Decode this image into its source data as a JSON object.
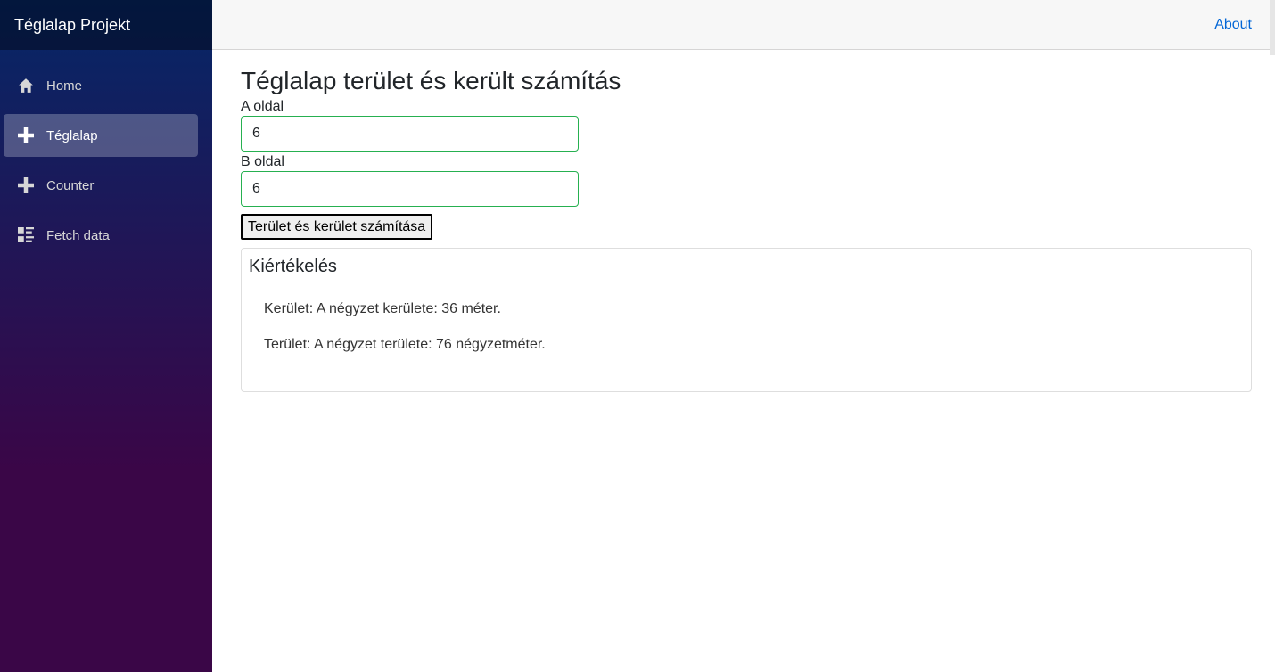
{
  "app": {
    "brand": "Téglalap Projekt"
  },
  "sidebar": {
    "items": [
      {
        "label": "Home",
        "icon": "home-icon",
        "active": false
      },
      {
        "label": "Téglalap",
        "icon": "plus-icon",
        "active": true
      },
      {
        "label": "Counter",
        "icon": "plus-icon",
        "active": false
      },
      {
        "label": "Fetch data",
        "icon": "list-rich-icon",
        "active": false
      }
    ]
  },
  "header": {
    "about_label": "About"
  },
  "main": {
    "title": "Téglalap terület és került számítás",
    "side_a": {
      "label": "A oldal",
      "value": "6"
    },
    "side_b": {
      "label": "B oldal",
      "value": "6"
    },
    "calculate_label": "Terület és kerület számítása",
    "result": {
      "title": "Kiértékelés",
      "perimeter_text": "Kerület: A négyzet kerülete: 36 méter.",
      "area_text": "Terület: A négyzet területe: 76 négyzetméter."
    }
  },
  "colors": {
    "sidebar_gradient_top": "#052767",
    "sidebar_gradient_bottom": "#3a0647",
    "input_border_valid": "#26b050",
    "link": "#0366d6"
  }
}
